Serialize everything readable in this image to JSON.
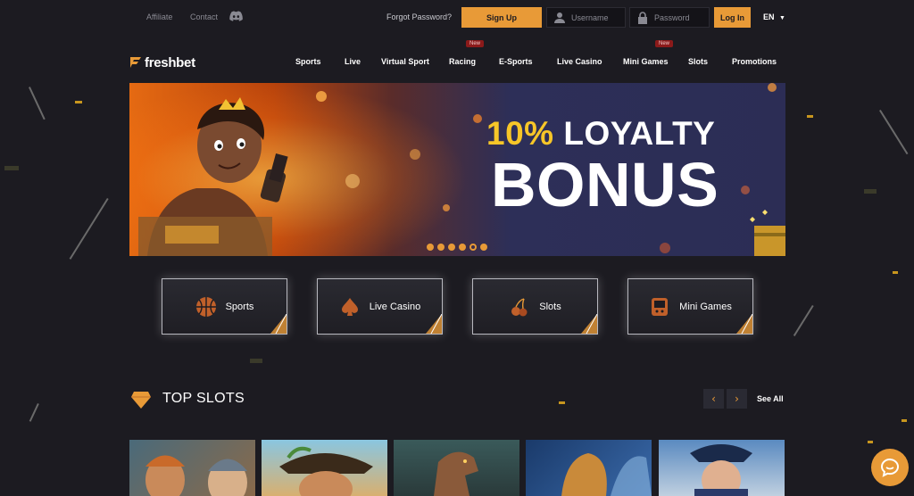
{
  "colors": {
    "accent": "#e89a37",
    "background": "#1c1b21",
    "banner_highlight": "#f7c628",
    "badge_new": "#8b1a1a"
  },
  "topbar": {
    "affiliate": "Affiliate",
    "contact": "Contact",
    "discord_icon": "discord-icon",
    "forgot_password": "Forgot Password?",
    "signup": "Sign Up",
    "username_placeholder": "Username",
    "password_placeholder": "Password",
    "login": "Log In",
    "language": "EN"
  },
  "brand": {
    "logo_text": "freshbet"
  },
  "nav": {
    "items": [
      {
        "label": "Sports"
      },
      {
        "label": "Live"
      },
      {
        "label": "Virtual Sport"
      },
      {
        "label": "Racing",
        "badge": "New"
      },
      {
        "label": "E-Sports"
      },
      {
        "label": "Live Casino"
      },
      {
        "label": "Mini Games",
        "badge": "New"
      },
      {
        "label": "Slots"
      },
      {
        "label": "Promotions"
      }
    ]
  },
  "banner": {
    "line1_highlight": "10%",
    "line1_rest": "LOYALTY",
    "line2": "BONUS",
    "slide_count": 6,
    "active_slide": 5
  },
  "categories": [
    {
      "label": "Sports",
      "icon": "basketball-icon"
    },
    {
      "label": "Live Casino",
      "icon": "spade-icon"
    },
    {
      "label": "Slots",
      "icon": "cherry-icon"
    },
    {
      "label": "Mini Games",
      "icon": "game-console-icon"
    }
  ],
  "top_slots": {
    "title": "TOP SLOTS",
    "see_all": "See All",
    "prev_icon": "chevron-left-icon",
    "next_icon": "chevron-right-icon"
  },
  "chat": {
    "icon": "chat-bubble-icon"
  }
}
